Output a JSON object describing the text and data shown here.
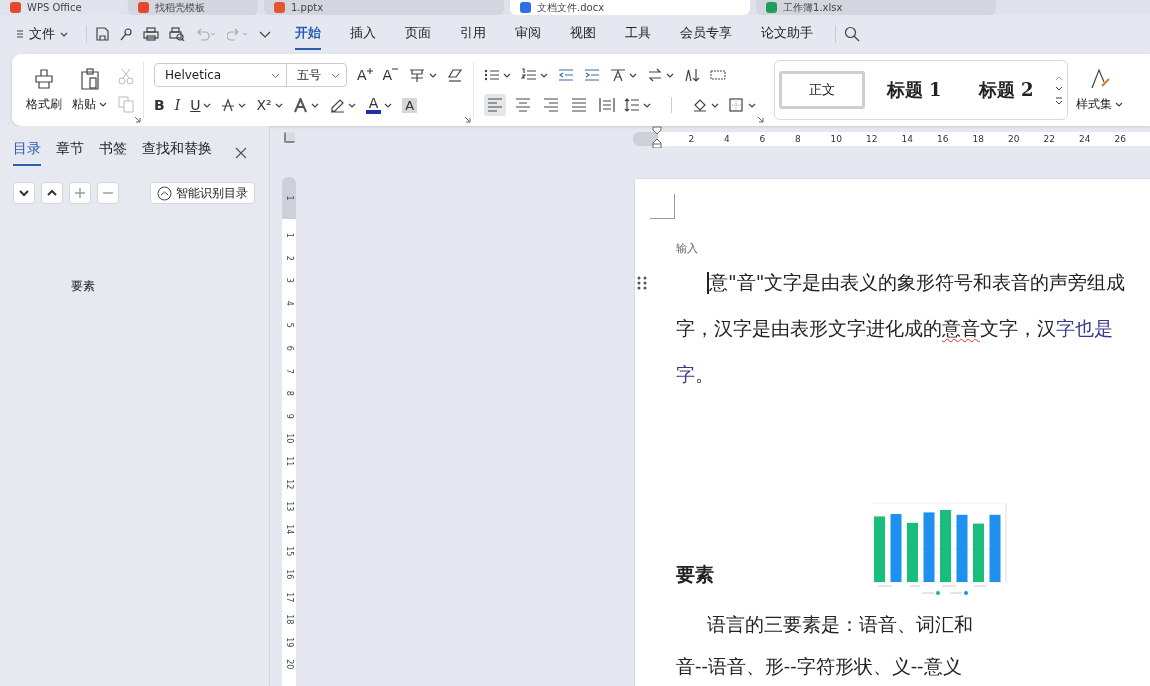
{
  "app_tabs": [
    {
      "label": "WPS Office",
      "selected": false,
      "color": "#e8472f"
    },
    {
      "label": "找稻壳模板",
      "selected": false,
      "color": "#e8472f"
    },
    {
      "label": "1.pptx",
      "selected": false,
      "color": "#e2572d"
    },
    {
      "label": "文档文件.docx",
      "selected": true,
      "color": "#2f6fe6"
    },
    {
      "label": "工作簿1.xlsx",
      "selected": false,
      "color": "#1e9e5a"
    }
  ],
  "menu": {
    "file": "文件",
    "tabs": [
      {
        "label": "开始",
        "selected": true
      },
      {
        "label": "插入",
        "selected": false
      },
      {
        "label": "页面",
        "selected": false
      },
      {
        "label": "引用",
        "selected": false
      },
      {
        "label": "审阅",
        "selected": false
      },
      {
        "label": "视图",
        "selected": false
      },
      {
        "label": "工具",
        "selected": false
      },
      {
        "label": "会员专享",
        "selected": false
      },
      {
        "label": "论文助手",
        "selected": false
      }
    ]
  },
  "ribbon": {
    "format_painter": "格式刷",
    "paste": "粘贴",
    "font": "Helvetica",
    "size": "五号",
    "glyphs": {
      "grow": "A",
      "shrink": "A",
      "bold": "B",
      "italic": "I",
      "underline": "U",
      "superscript": "X²",
      "font_color": "A",
      "shade": "A"
    },
    "alignment": [
      {
        "selected": true
      },
      {
        "selected": false
      },
      {
        "selected": false
      },
      {
        "selected": false
      },
      {
        "selected": false
      }
    ],
    "styles": [
      {
        "label": "正文",
        "selected": true
      },
      {
        "label": "标题 1",
        "selected": false
      },
      {
        "label": "标题 2",
        "selected": false
      }
    ],
    "style_set": "样式集"
  },
  "nav": {
    "tabs": [
      {
        "label": "目录",
        "selected": true
      },
      {
        "label": "章节",
        "selected": false
      },
      {
        "label": "书签",
        "selected": false
      },
      {
        "label": "查找和替换",
        "selected": false
      }
    ],
    "smart_button": "智能识别目录",
    "items": [
      {
        "label": "要素"
      }
    ]
  },
  "rulers": {
    "horizontal": [
      "2",
      "4",
      "6",
      "8",
      "10",
      "12",
      "14",
      "16",
      "18",
      "20",
      "22",
      "24",
      "26"
    ],
    "vertical": [
      "1",
      "1",
      "2",
      "3",
      "4",
      "5",
      "6",
      "7",
      "8",
      "9",
      "10",
      "11",
      "12",
      "13",
      "14",
      "15",
      "16",
      "17",
      "18",
      "19",
      "20"
    ]
  },
  "document": {
    "hint": "输入",
    "lines": [
      {
        "indent": true,
        "segments": [
          {
            "kind": "plain",
            "text": "意\"音\"文字是由表义的象形符号和表音的声旁组成"
          }
        ]
      },
      {
        "indent": false,
        "segments": [
          {
            "kind": "plain",
            "text": "字，汉字是由表形文字进化成的"
          },
          {
            "kind": "misspelled",
            "text": "意音"
          },
          {
            "kind": "plain",
            "text": "文字，汉"
          },
          {
            "kind": "link",
            "text": "字也是"
          }
        ]
      },
      {
        "indent": false,
        "segments": [
          {
            "kind": "link",
            "text": "字"
          },
          {
            "kind": "plain",
            "text": "。"
          }
        ]
      }
    ],
    "heading": "要素",
    "after": [
      {
        "indent": true,
        "segments": [
          {
            "kind": "plain",
            "text": "语言的三要素是：语音、词汇和"
          }
        ]
      },
      {
        "indent": false,
        "segments": [
          {
            "kind": "plain",
            "text": "音--语音、形--字符形状、义--意义"
          }
        ]
      }
    ]
  }
}
